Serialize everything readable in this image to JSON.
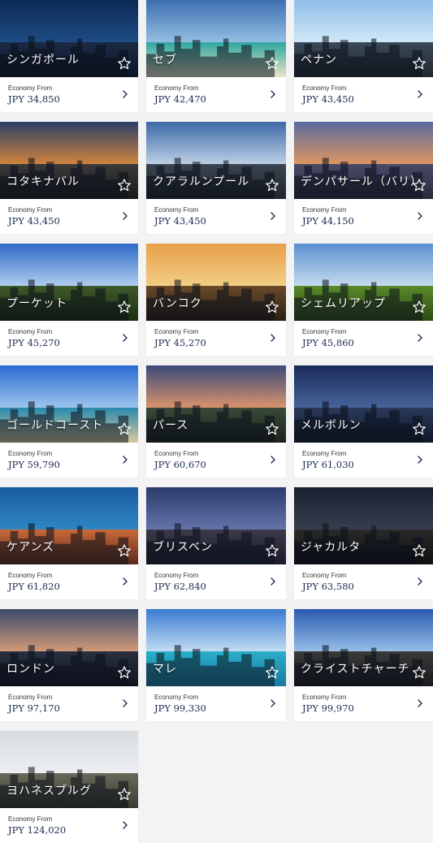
{
  "destinations": [
    {
      "name": "シンガポール",
      "label": "Economy From",
      "price": "JPY 34,850",
      "sky": "linear-gradient(#0d2a55,#1f4f8a)",
      "ground": "linear-gradient(#1b2a44,#0e1626)",
      "accent": "#7fd3ff"
    },
    {
      "name": "セブ",
      "label": "Economy From",
      "price": "JPY 42,470",
      "sky": "linear-gradient(#3d6fb0,#9cc6e8)",
      "ground": "linear-gradient(#2fa7a0,#e9e3c8)",
      "accent": "#3d8a3a"
    },
    {
      "name": "ペナン",
      "label": "Economy From",
      "price": "JPY 43,450",
      "sky": "linear-gradient(#8fbfe8,#d6ebf8)",
      "ground": "linear-gradient(#3a4a5a,#20282e)",
      "accent": "#c44a3a"
    },
    {
      "name": "コタキナバル",
      "label": "Economy From",
      "price": "JPY 43,450",
      "sky": "linear-gradient(#2a3f66,#e08a3a)",
      "ground": "linear-gradient(#3a3a3a,#1a1a1a)",
      "accent": "#f0b060"
    },
    {
      "name": "クアラルンプール",
      "label": "Economy From",
      "price": "JPY 43,450",
      "sky": "linear-gradient(#3c6aa8,#c9d8ea)",
      "ground": "linear-gradient(#3a4450,#1f252c)",
      "accent": "#9aa8b8"
    },
    {
      "name": "デンパサール（バリ）",
      "label": "Economy From",
      "price": "JPY 44,150",
      "sky": "linear-gradient(#5a6aa0,#e89a5a)",
      "ground": "linear-gradient(#4a4a6a,#2a2a3a)",
      "accent": "#f0a060"
    },
    {
      "name": "プーケット",
      "label": "Economy From",
      "price": "JPY 45,270",
      "sky": "linear-gradient(#2f6ac8,#bcd6f2)",
      "ground": "linear-gradient(#3e5a2a,#1e2e14)",
      "accent": "#d9a04a"
    },
    {
      "name": "バンコク",
      "label": "Economy From",
      "price": "JPY 45,270",
      "sky": "linear-gradient(#e8a04a,#f2d28a)",
      "ground": "linear-gradient(#6a4a2a,#2a1e12)",
      "accent": "#e8c060"
    },
    {
      "name": "シェムリアップ",
      "label": "Economy From",
      "price": "JPY 45,860",
      "sky": "linear-gradient(#5a8fd0,#cfe2f2)",
      "ground": "linear-gradient(#5a8a2a,#2e4a16)",
      "accent": "#8a6a3a"
    },
    {
      "name": "ゴールドコースト",
      "label": "Economy From",
      "price": "JPY 59,790",
      "sky": "linear-gradient(#2a6ad0,#a8cdf0)",
      "ground": "linear-gradient(#2a8ab0,#d8c89a)",
      "accent": "#e0e0e0"
    },
    {
      "name": "パース",
      "label": "Economy From",
      "price": "JPY 60,670",
      "sky": "linear-gradient(#3a4a7a,#e89a6a)",
      "ground": "linear-gradient(#3a4a3a,#1a221a)",
      "accent": "#f0c090"
    },
    {
      "name": "メルボルン",
      "label": "Economy From",
      "price": "JPY 61,030",
      "sky": "linear-gradient(#1a2a5a,#4a6aa0)",
      "ground": "linear-gradient(#2a3a5a,#101828)",
      "accent": "#c0d0f0"
    },
    {
      "name": "ケアンズ",
      "label": "Economy From",
      "price": "JPY 61,820",
      "sky": "linear-gradient(#1a5aa0,#2f8ac8)",
      "ground": "linear-gradient(#c86a3a,#5a2a1a)",
      "accent": "#f08a3a"
    },
    {
      "name": "ブリスベン",
      "label": "Economy From",
      "price": "JPY 62,840",
      "sky": "linear-gradient(#2a3a6a,#6a7ab0)",
      "ground": "linear-gradient(#3a3a4a,#1a1a2a)",
      "accent": "#f0c060"
    },
    {
      "name": "ジャカルタ",
      "label": "Economy From",
      "price": "JPY 63,580",
      "sky": "linear-gradient(#1a2030,#3a4050)",
      "ground": "linear-gradient(#2a2a2a,#101010)",
      "accent": "#f06a3a"
    },
    {
      "name": "ロンドン",
      "label": "Economy From",
      "price": "JPY 97,170",
      "sky": "linear-gradient(#3a4a6a,#e0a07a)",
      "ground": "linear-gradient(#2a3040,#101420)",
      "accent": "#e0b08a"
    },
    {
      "name": "マレ",
      "label": "Economy From",
      "price": "JPY 99,330",
      "sky": "linear-gradient(#3a7ad0,#cfe6f6)",
      "ground": "linear-gradient(#2ab0c8,#1a7aa0)",
      "accent": "#c8a070"
    },
    {
      "name": "クライストチャーチ",
      "label": "Economy From",
      "price": "JPY 99,970",
      "sky": "linear-gradient(#2a5ab0,#a0c8ec)",
      "ground": "linear-gradient(#3a3a3a,#1a1a1a)",
      "accent": "#a09a90"
    },
    {
      "name": "ヨハネスブルグ",
      "label": "Economy From",
      "price": "JPY 124,020",
      "sky": "linear-gradient(#d8dde2,#eef0f2)",
      "ground": "linear-gradient(#6a6a5a,#3a3a30)",
      "accent": "#8a8a7a"
    }
  ]
}
